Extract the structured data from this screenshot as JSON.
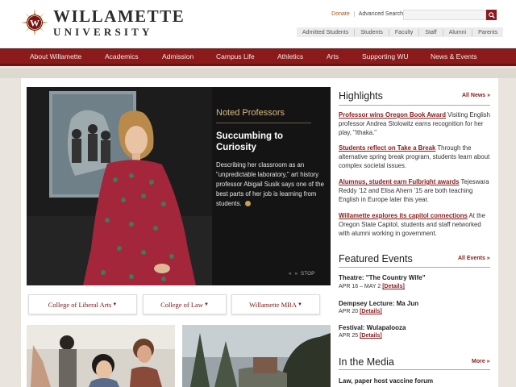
{
  "header": {
    "logo_line1": "WILLAMETTE",
    "logo_line2": "UNIVERSITY",
    "donate": "Donate",
    "advanced_search": "Advanced Search",
    "search_placeholder": "",
    "audience_links": [
      "Admitted Students",
      "Students",
      "Faculty",
      "Staff",
      "Alumni",
      "Parents"
    ]
  },
  "nav": {
    "items": [
      "About Willamette",
      "Academics",
      "Admission",
      "Campus Life",
      "Athletics",
      "Arts",
      "Supporting WU",
      "News & Events"
    ]
  },
  "hero": {
    "kicker": "Noted Professors",
    "title": "Succumbing to Curiosity",
    "description": "Describing her classroom as an \"unpredictable laboratory,\" art history professor Abigail Susik says one of the best parts of her job is learning from students.",
    "controls": "STOP"
  },
  "colleges": [
    {
      "label": "College of Liberal Arts"
    },
    {
      "label": "College of Law"
    },
    {
      "label": "Willamette MBA"
    }
  ],
  "highlights": {
    "title": "Highlights",
    "more": "All News »",
    "items": [
      {
        "headline": "Professor wins Oregon Book Award",
        "text": " Visiting English professor Andrea Stolowitz earns recognition for her play, \"Ithaka.\""
      },
      {
        "headline": "Students reflect on Take a Break",
        "text": " Through the alternative spring break program, students learn about complex societal issues."
      },
      {
        "headline": "Alumnus, student earn Fulbright awards",
        "text": " Tejeswara Reddy '12 and Elisa Ahern '15 are both teaching English in Europe later this year."
      },
      {
        "headline": "Willamette explores its capitol connections",
        "text": " At the Oregon State Capitol, students and staff networked with alumni working in government."
      }
    ]
  },
  "events": {
    "title": "Featured Events",
    "more": "All Events »",
    "items": [
      {
        "title": "Theatre: \"The Country Wife\"",
        "date": "APR 16 – MAY 2 ",
        "details": "[Details]"
      },
      {
        "title": "Dempsey Lecture: Ma Jun",
        "date": "APR 20 ",
        "details": "[Details]"
      },
      {
        "title": "Festival: Wulapalooza",
        "date": "APR 25 ",
        "details": "[Details]"
      }
    ]
  },
  "media": {
    "title": "In the Media",
    "more": "More »",
    "items": [
      {
        "title": "Law, paper host vaccine forum"
      }
    ]
  },
  "colors": {
    "brand": "#8b1a1a",
    "accent_gold": "#c8a050"
  }
}
